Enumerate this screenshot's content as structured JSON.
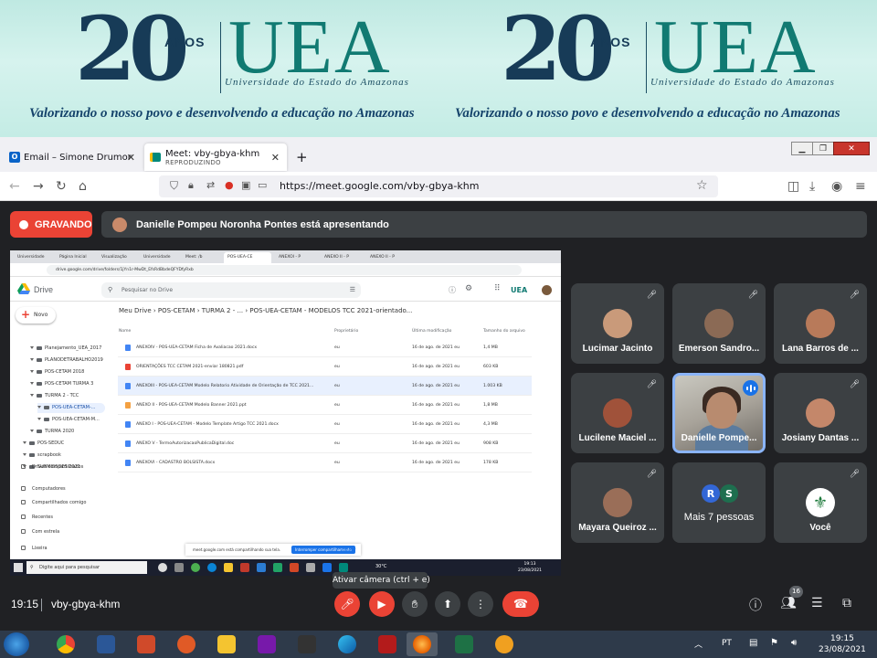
{
  "banner": {
    "twenty": "20",
    "anos": "ANOS",
    "uea": "UEA",
    "university": "Universidade do Estado do Amazonas",
    "slogan": "Valorizando o nosso povo e desenvolvendo a educação no Amazonas"
  },
  "browser": {
    "tabs": [
      {
        "label": "Email – Simone Drumond – Out"
      },
      {
        "label": "Meet: vby-gbya-khm",
        "sublabel": "REPRODUZINDO"
      }
    ],
    "new_tab": "+",
    "url": "https://meet.google.com/vby-gbya-khm"
  },
  "meet": {
    "recording_label": "GRAVANDO",
    "presenting_text": "Danielle Pompeu Noronha Pontes está apresentando",
    "participants": [
      {
        "name": "Lucimar Jacinto",
        "color": "#c99a7a"
      },
      {
        "name": "Emerson Sandro...",
        "color": "#8b6a55"
      },
      {
        "name": "Lana Barros de ...",
        "color": "#b87a5a"
      },
      {
        "name": "Lucilene Maciel ...",
        "color": "#a0523a"
      },
      {
        "name": "Danielle Pompe...",
        "color": "#b88b6f"
      },
      {
        "name": "Josiany Dantas ...",
        "color": "#c4876a"
      },
      {
        "name": "Mayara Queiroz ...",
        "color": "#9a6e58"
      },
      {
        "name": "Mais 7 pessoas",
        "initials": [
          "R",
          "S"
        ]
      },
      {
        "name": "Você",
        "color": "#ffffff"
      }
    ],
    "tooltip": "Ativar câmera (ctrl + e)",
    "clock": "19:15",
    "meeting_code": "vby-gbya-khm",
    "people_count": "16"
  },
  "shared": {
    "tabs": [
      "Universidade",
      "Página Inicial",
      "Visualização",
      "Universidade",
      "Meet: /b",
      "POS-UEA-CE",
      "ANEXOI - P",
      "ANEXO II - P",
      "ANEXO II - P"
    ],
    "url": "drive.google.com/drive/folders/1jYn1r-MwDt_EfsRdBbdeQFYDfyRxb",
    "app_name": "Drive",
    "search_placeholder": "Pesquisar no Drive",
    "org_badge": "UEA",
    "new_button": "Novo",
    "tree": [
      "Planejamento_UEA_2017",
      "PLANODETRABALHO2019",
      "POS-CETAM 2018",
      "POS-CETAM TURMA 3",
      "TURMA 2 - TCC",
      "POS-UEA-CETAM-...",
      "POS-UEA-CETAM-M...",
      "TURMA 2020",
      "POS-SEDUC",
      "scrapbook",
      "SUBMISSOES 2021"
    ],
    "sidebar": [
      "Drives compartilhados",
      "Computadores",
      "Compartilhados comigo",
      "Recentes",
      "Com estrela",
      "Lixeira"
    ],
    "breadcrumb": "Meu Drive  ›  POS-CETAM  ›  TURMA 2 - ...  ›  POS-UEA-CETAM - MODELOS TCC 2021-orientado...",
    "columns": {
      "name": "Nome",
      "owner": "Proprietário",
      "modified": "Última modificação",
      "size": "Tamanho do arquivo"
    },
    "files": [
      {
        "name": "ANEXOIV - POS-UEA-CETAM Ficha de Avaliacao 2021.docx",
        "owner": "eu",
        "date": "16 de ago. de 2021 eu",
        "size": "1,4 MB",
        "color": "#4285f4"
      },
      {
        "name": "ORIENTAÇÕES TCC CETAM 2021-enviar 180821.pdf",
        "owner": "eu",
        "date": "16 de ago. de 2021 eu",
        "size": "603 KB",
        "color": "#ea4335"
      },
      {
        "name": "ANEXOIII - POS-UEA-CETAM Modelo Relatorio Atividade de Orientação de TCC 2021...",
        "owner": "eu",
        "date": "16 de ago. de 2021 eu",
        "size": "1.003 KB",
        "color": "#4285f4"
      },
      {
        "name": "ANEXO II - POS-UEA-CETAM Modelo Banner 2021.ppt",
        "owner": "eu",
        "date": "16 de ago. de 2021 eu",
        "size": "1,8 MB",
        "color": "#f4a142"
      },
      {
        "name": "ANEXO I - POS-UEA-CETAM - Modelo Template Artigo TCC 2021.docx",
        "owner": "eu",
        "date": "16 de ago. de 2021 eu",
        "size": "4,3 MB",
        "color": "#4285f4"
      },
      {
        "name": "ANEXO V - TermoAutorizacaoPublicaDigital.doc",
        "owner": "eu",
        "date": "16 de ago. de 2021 eu",
        "size": "908 KB",
        "color": "#4285f4"
      },
      {
        "name": "ANEXOVI - CADASTRO BOLSISTA.docx",
        "owner": "eu",
        "date": "16 de ago. de 2021 eu",
        "size": "178 KB",
        "color": "#4285f4"
      }
    ],
    "toast_text": "meet.google.com está compartilhando sua tela.",
    "toast_stop": "Interromper compartilhamento",
    "toast_hide": "Ocultar",
    "taskbar_search": "Digite aqui para pesquisar",
    "taskbar_temp": "30°C",
    "taskbar_time": "19:13",
    "taskbar_date": "23/08/2021"
  },
  "windows": {
    "lang": "PT",
    "time": "19:15",
    "date": "23/08/2021"
  }
}
